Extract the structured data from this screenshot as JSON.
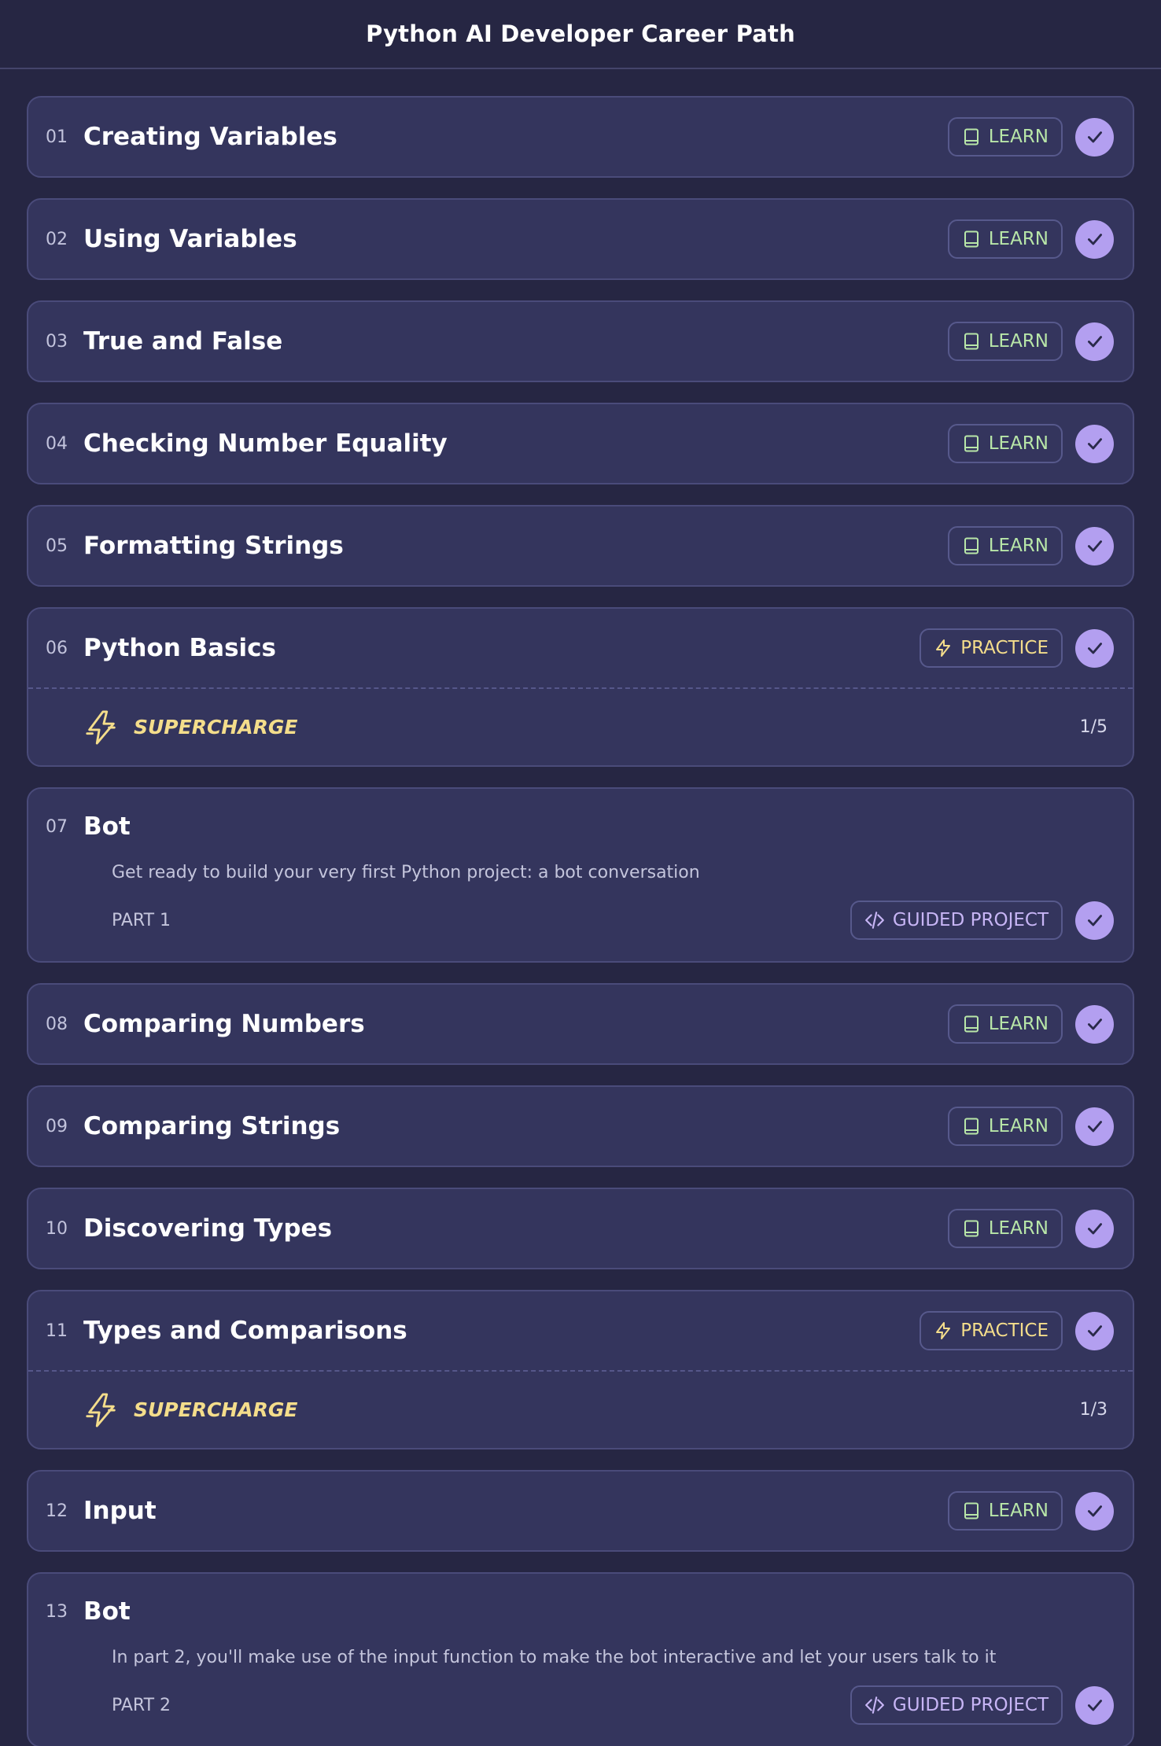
{
  "header": {
    "title": "Python AI Developer Career Path"
  },
  "lessons": [
    {
      "num": "01",
      "title": "Creating Variables",
      "badge": "LEARN"
    },
    {
      "num": "02",
      "title": "Using Variables",
      "badge": "LEARN"
    },
    {
      "num": "03",
      "title": "True and False",
      "badge": "LEARN"
    },
    {
      "num": "04",
      "title": "Checking Number Equality",
      "badge": "LEARN"
    },
    {
      "num": "05",
      "title": "Formatting Strings",
      "badge": "LEARN"
    },
    {
      "num": "06",
      "title": "Python Basics",
      "badge": "PRACTICE",
      "supercharge_label": "SUPERCHARGE",
      "supercharge_progress": "1/5"
    },
    {
      "num": "07",
      "title": "Bot",
      "description": "Get ready to build your very first Python project: a bot conversation",
      "part": "PART 1",
      "badge": "GUIDED PROJECT"
    },
    {
      "num": "08",
      "title": "Comparing Numbers",
      "badge": "LEARN"
    },
    {
      "num": "09",
      "title": "Comparing Strings",
      "badge": "LEARN"
    },
    {
      "num": "10",
      "title": "Discovering Types",
      "badge": "LEARN"
    },
    {
      "num": "11",
      "title": "Types and Comparisons",
      "badge": "PRACTICE",
      "supercharge_label": "SUPERCHARGE",
      "supercharge_progress": "1/3"
    },
    {
      "num": "12",
      "title": "Input",
      "badge": "LEARN"
    },
    {
      "num": "13",
      "title": "Bot",
      "description": "In part 2, you'll make use of the input function to make the bot interactive and let your users talk to it",
      "part": "PART 2",
      "badge": "GUIDED PROJECT"
    }
  ],
  "icons": {
    "learn": "book-icon",
    "practice": "lightning-icon",
    "guided": "code-icon",
    "complete": "checkmark-icon",
    "supercharge": "supercharge-bolt-icon"
  },
  "colors": {
    "background": "#262643",
    "card": "#34355d",
    "learn": "#b8e6a8",
    "practice": "#f4dd8b",
    "guided": "#c7b5f5",
    "check": "#b39ff0"
  }
}
